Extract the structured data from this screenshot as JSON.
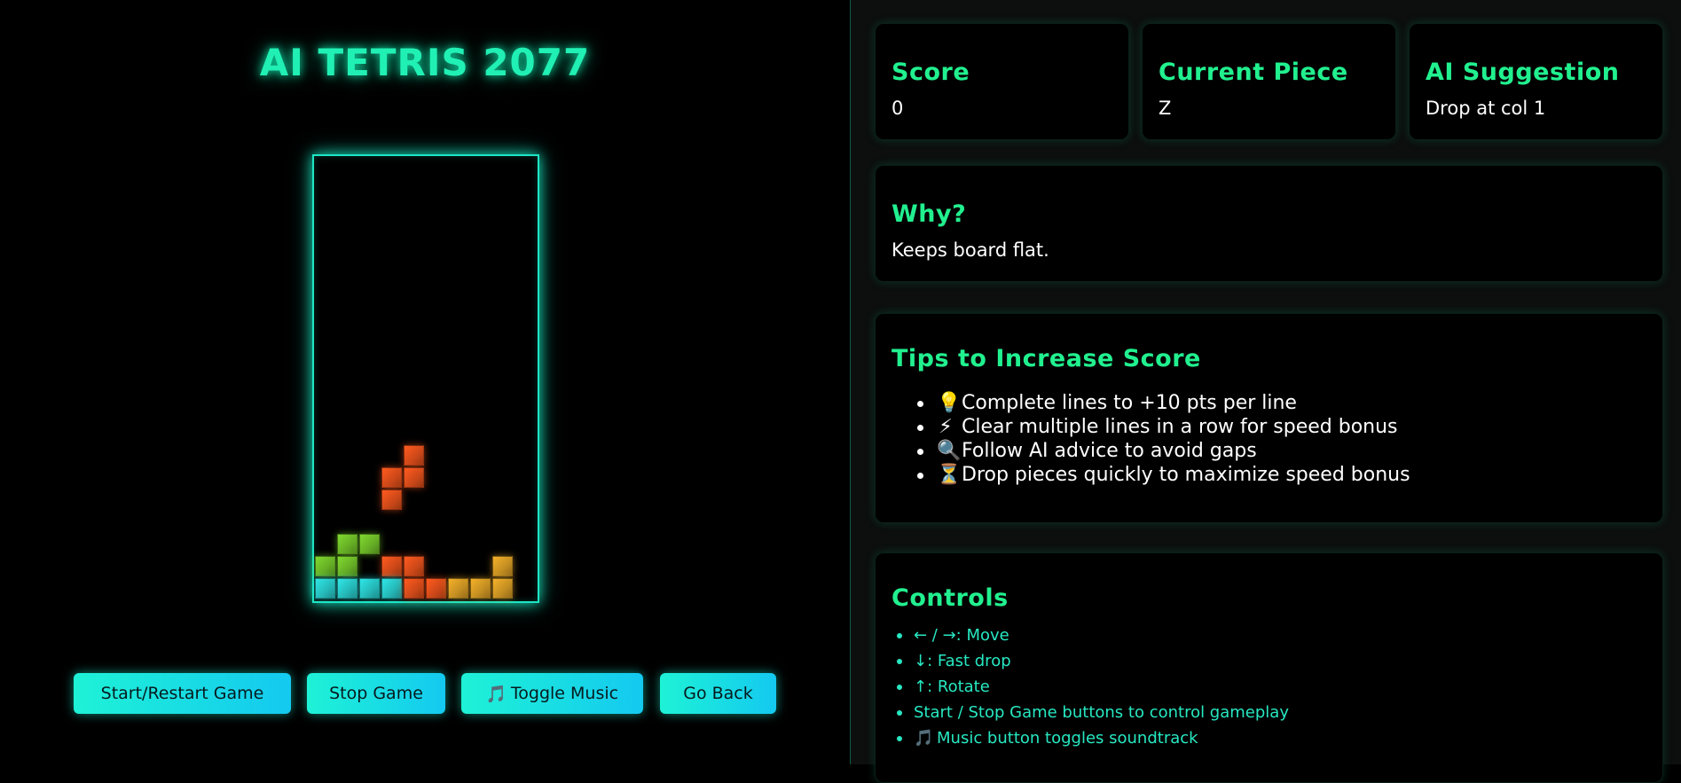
{
  "title": "AI TETRIS 2077",
  "board": {
    "cols": 10,
    "rows": 20,
    "cells": [
      {
        "r": 13,
        "c": 4,
        "color": "#ff5a1f"
      },
      {
        "r": 14,
        "c": 3,
        "color": "#ff5a1f"
      },
      {
        "r": 14,
        "c": 4,
        "color": "#ff5a1f"
      },
      {
        "r": 15,
        "c": 3,
        "color": "#ff5a1f"
      },
      {
        "r": 17,
        "c": 1,
        "color": "#7fd92f"
      },
      {
        "r": 17,
        "c": 2,
        "color": "#7fd92f"
      },
      {
        "r": 18,
        "c": 0,
        "color": "#7fd92f"
      },
      {
        "r": 18,
        "c": 1,
        "color": "#7fd92f"
      },
      {
        "r": 18,
        "c": 3,
        "color": "#ff5a1f"
      },
      {
        "r": 18,
        "c": 4,
        "color": "#ff5a1f"
      },
      {
        "r": 18,
        "c": 8,
        "color": "#f4b12a"
      },
      {
        "r": 19,
        "c": 0,
        "color": "#2fe6e6"
      },
      {
        "r": 19,
        "c": 1,
        "color": "#2fe6e6"
      },
      {
        "r": 19,
        "c": 2,
        "color": "#2fe6e6"
      },
      {
        "r": 19,
        "c": 3,
        "color": "#2fe6e6"
      },
      {
        "r": 19,
        "c": 4,
        "color": "#ff5a1f"
      },
      {
        "r": 19,
        "c": 5,
        "color": "#ff5a1f"
      },
      {
        "r": 19,
        "c": 6,
        "color": "#f4b12a"
      },
      {
        "r": 19,
        "c": 7,
        "color": "#f4b12a"
      },
      {
        "r": 19,
        "c": 8,
        "color": "#f4b12a"
      }
    ]
  },
  "buttons": {
    "start": "Start/Restart Game",
    "stop": "Stop Game",
    "music": "Toggle Music",
    "music_icon": "🎵",
    "back": "Go Back"
  },
  "stats": {
    "score_label": "Score",
    "score_value": "0",
    "piece_label": "Current Piece",
    "piece_value": "Z",
    "ai_label": "AI Suggestion",
    "ai_value": "Drop at col 1"
  },
  "why": {
    "label": "Why?",
    "text": "Keeps board flat."
  },
  "tips": {
    "label": "Tips to Increase Score",
    "items": [
      {
        "icon": "💡",
        "text": "Complete lines to +10 pts per line"
      },
      {
        "icon": "⚡",
        "text": "Clear multiple lines in a row for speed bonus"
      },
      {
        "icon": "🔍",
        "text": "Follow AI advice to avoid gaps"
      },
      {
        "icon": "⏳",
        "text": "Drop pieces quickly to maximize speed bonus"
      }
    ]
  },
  "controls": {
    "label": "Controls",
    "items": [
      {
        "icon": "",
        "text": "← / →: Move"
      },
      {
        "icon": "",
        "text": "↓: Fast drop"
      },
      {
        "icon": "",
        "text": "↑: Rotate"
      },
      {
        "icon": "",
        "text": "Start / Stop Game buttons to control gameplay"
      },
      {
        "icon": "🎵",
        "text": "Music button toggles soundtrack"
      }
    ]
  },
  "colors": {
    "accent": "#21f08f",
    "board_border": "#1de6c4",
    "button": "#1ef2d6"
  }
}
